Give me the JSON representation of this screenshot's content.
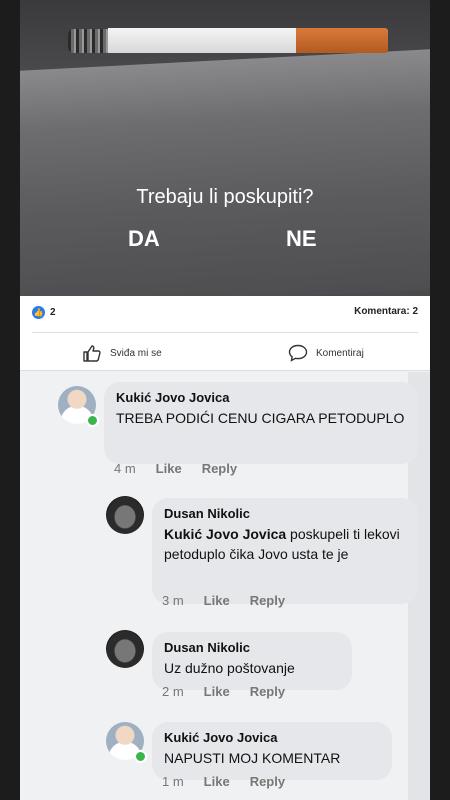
{
  "post": {
    "question": "Trebaju li poskupiti?",
    "option_yes": "DA",
    "option_no": "NE"
  },
  "reactions": {
    "like_count": "2",
    "comment_count": "Komentara: 2",
    "like_action": "Sviđa mi se",
    "comment_action": "Komentiraj"
  },
  "comments": [
    {
      "author": "Kukić Jovo Jovica",
      "text": "TREBA PODIĆI CENU CIGARA PETODUPLO",
      "time": "4 m",
      "like": "Like",
      "reply": "Reply"
    },
    {
      "author": "Dusan Nikolic",
      "mention": "Kukić Jovo Jovica",
      "text": " poskupeli ti lekovi petoduplo čika Jovo usta te je",
      "time": "3 m",
      "like": "Like",
      "reply": "Reply"
    },
    {
      "author": "Dusan Nikolic",
      "text": "Uz dužno poštovanje",
      "time": "2 m",
      "like": "Like",
      "reply": "Reply"
    },
    {
      "author": "Kukić Jovo Jovica",
      "text": "NAPUSTI MOJ KOMENTAR",
      "time": "1 m",
      "like": "Like",
      "reply": "Reply"
    }
  ],
  "colors": {
    "like_blue": "#2b78f0",
    "online_green": "#3bb54a",
    "filter_orange": "#d97a3a"
  },
  "icons": [
    "cigarette-image",
    "like-reaction-icon",
    "thumb-up-icon",
    "comment-bubble-icon"
  ]
}
